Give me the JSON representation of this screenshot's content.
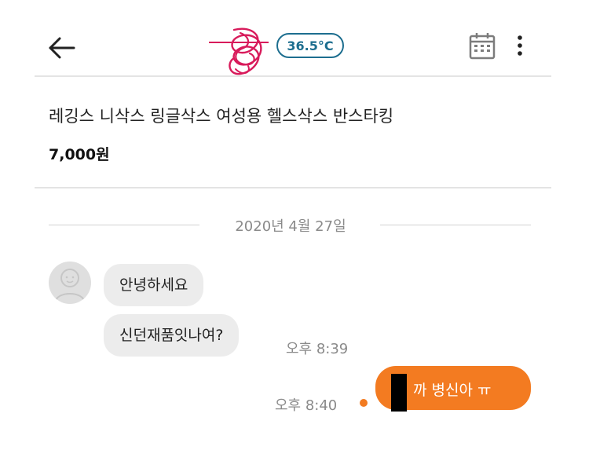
{
  "header": {
    "temperature": "36.5°C",
    "back_icon": "arrow-left-icon",
    "calendar_icon": "calendar-icon",
    "more_icon": "more-vertical-icon"
  },
  "product": {
    "title": "레깅스 니삭스 링글삭스 여성용 헬스삭스 반스타킹",
    "price": "7,000원"
  },
  "chat": {
    "date": "2020년 4월 27일",
    "messages_in": [
      {
        "text": "안녕하세요"
      },
      {
        "text": "신던재품잇나여?",
        "time": "오후 8:39"
      }
    ],
    "message_out": {
      "text": "까 병신아 ㅠ",
      "time": "오후 8:40"
    }
  },
  "colors": {
    "accent_orange": "#f37b21",
    "temperature_blue": "#1d6e8f",
    "bubble_gray": "#ececec"
  }
}
